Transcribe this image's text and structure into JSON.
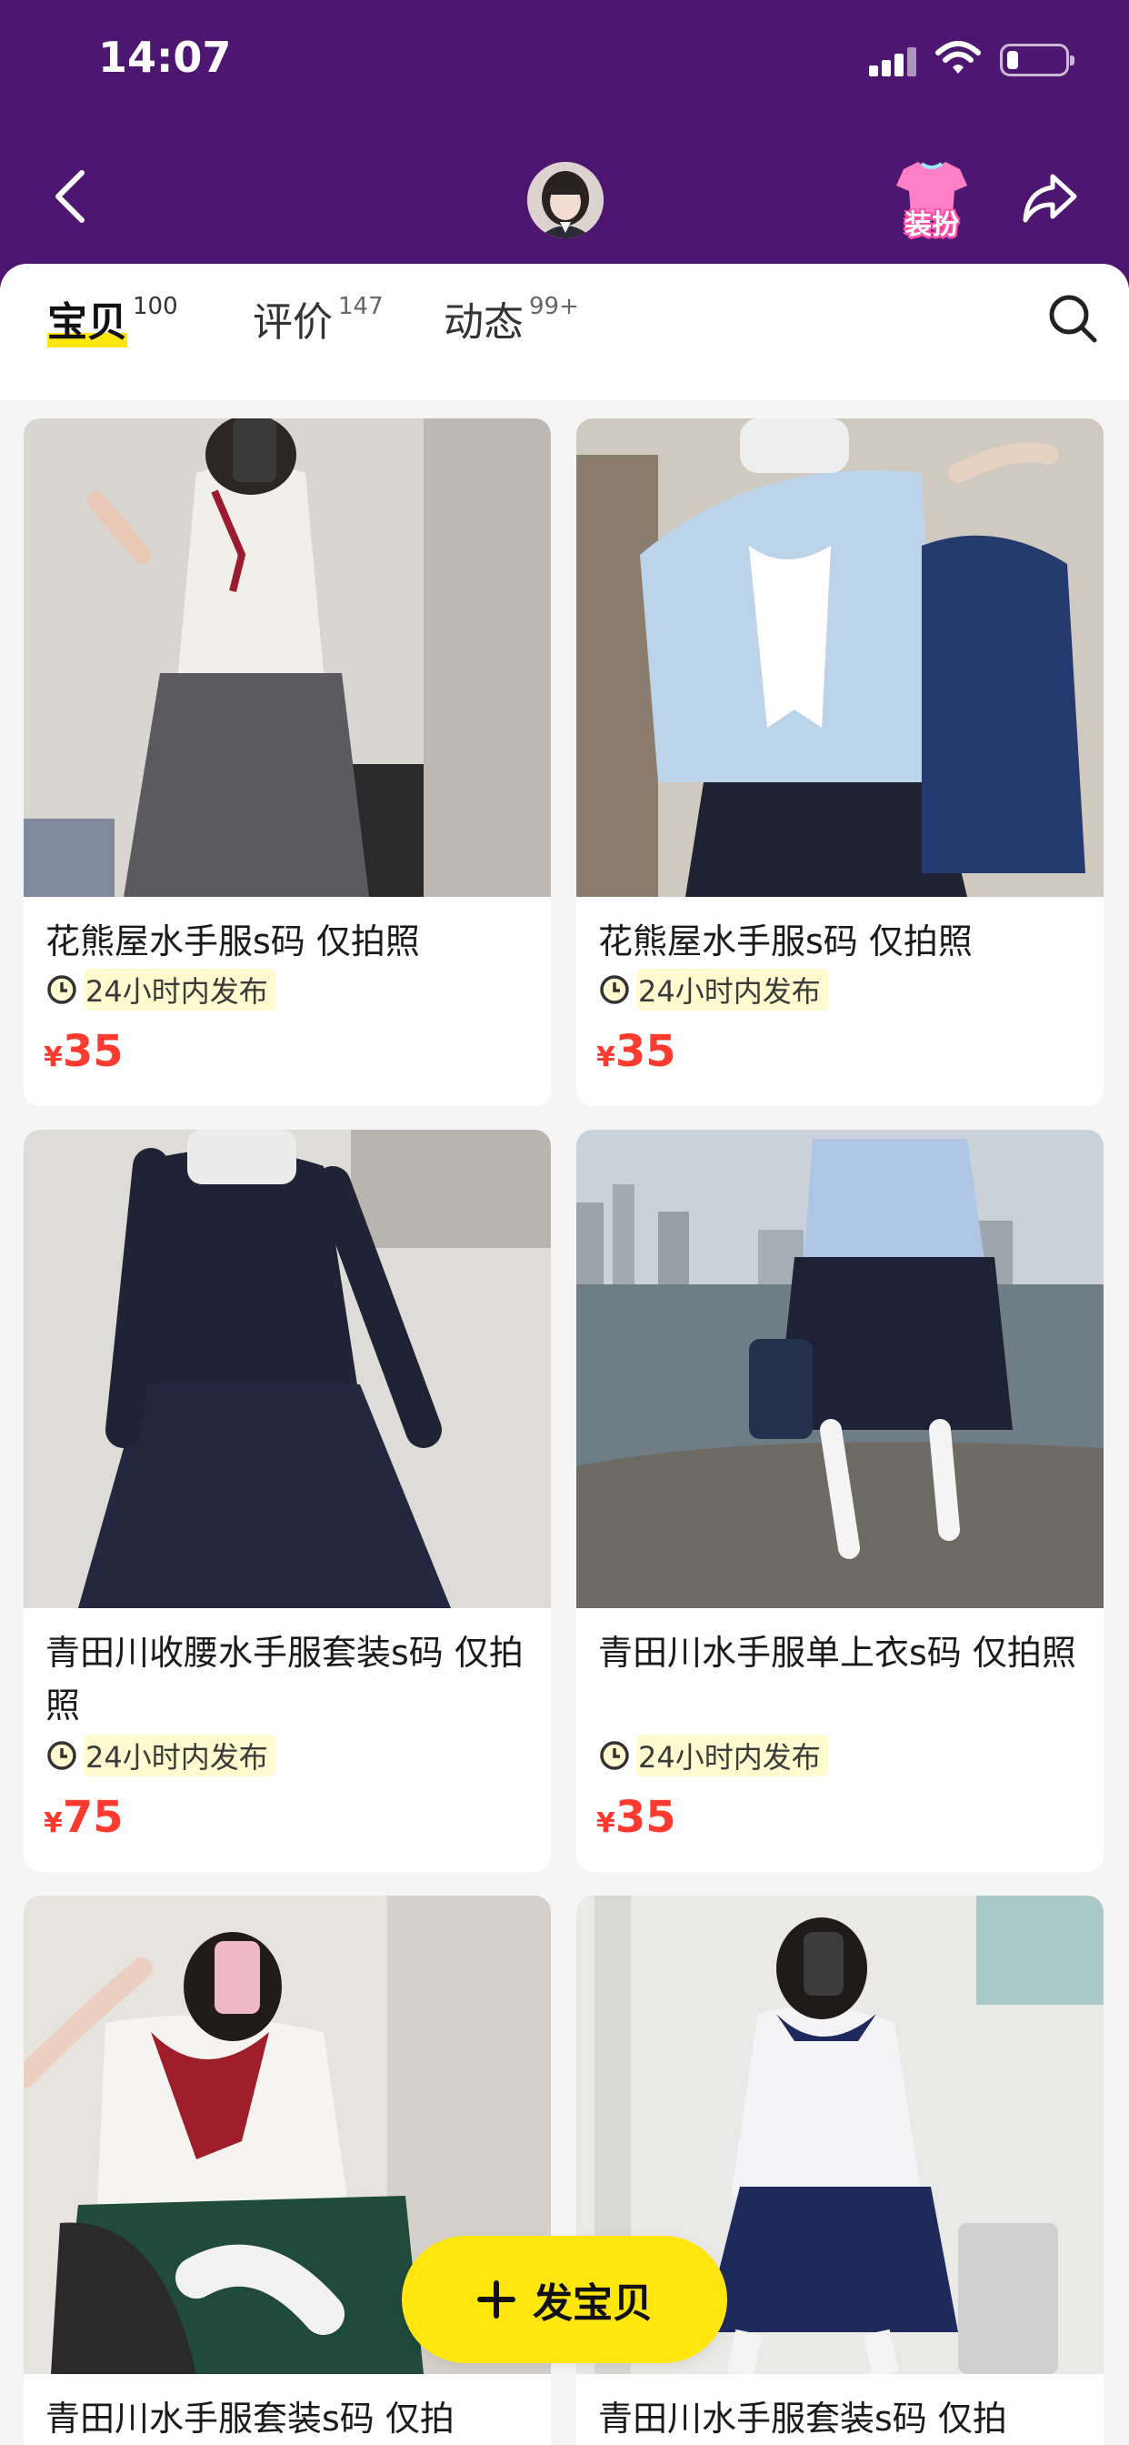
{
  "status_bar": {
    "time": "14:07"
  },
  "nav": {
    "dressup_label": "装扮",
    "icons": [
      "back-icon",
      "avatar",
      "dressup-icon",
      "share-icon"
    ]
  },
  "tabs": [
    {
      "label": "宝贝",
      "count": "100",
      "active": true
    },
    {
      "label": "评价",
      "count": "147",
      "active": false
    },
    {
      "label": "动态",
      "count": "99+",
      "active": false
    }
  ],
  "products": [
    {
      "title": "花熊屋水手服s码 仅拍照",
      "time": "24小时内发布",
      "currency": "¥",
      "price": "35"
    },
    {
      "title": "花熊屋水手服s码 仅拍照",
      "time": "24小时内发布",
      "currency": "¥",
      "price": "35"
    },
    {
      "title": "青田川收腰水手服套装s码 仅拍照",
      "time": "24小时内发布",
      "currency": "¥",
      "price": "75"
    },
    {
      "title": "青田川水手服单上衣s码 仅拍照",
      "time": "24小时内发布",
      "currency": "¥",
      "price": "35"
    },
    {
      "title": "青田川水手服套装s码 仅拍",
      "time": "",
      "currency": "",
      "price": ""
    },
    {
      "title": "青田川水手服套装s码 仅拍",
      "time": "",
      "currency": "",
      "price": ""
    }
  ],
  "post_button": {
    "label": "发宝贝"
  },
  "colors": {
    "header_bg": "#4d1670",
    "accent_yellow": "#ffe60f",
    "price_red": "#ff3b30"
  }
}
